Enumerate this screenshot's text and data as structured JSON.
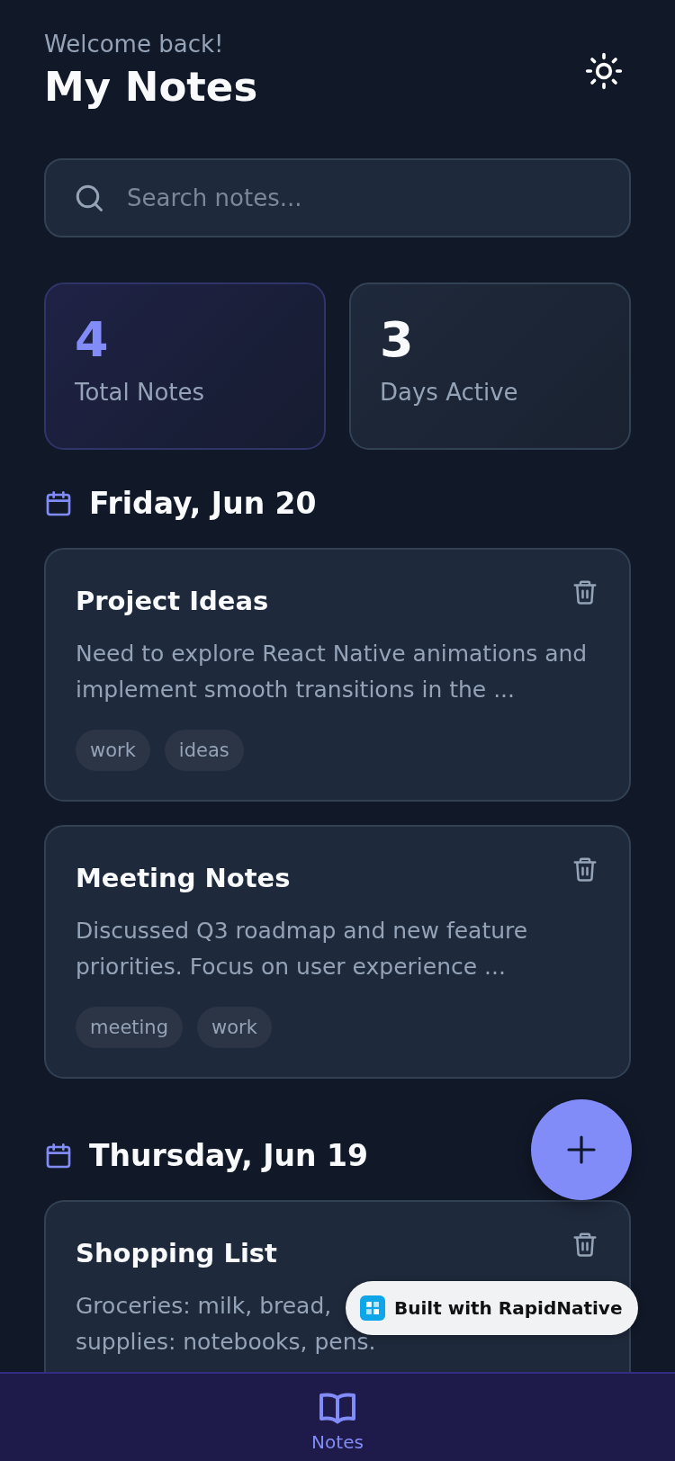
{
  "header": {
    "greeting": "Welcome back!",
    "title": "My Notes"
  },
  "search": {
    "placeholder": "Search notes..."
  },
  "stats": [
    {
      "value": "4",
      "label": "Total Notes",
      "kind": "accent"
    },
    {
      "value": "3",
      "label": "Days Active",
      "kind": "plain"
    }
  ],
  "groups": [
    {
      "date": "Friday, Jun 20",
      "notes": [
        {
          "title": "Project Ideas",
          "preview": "Need to explore React Native animations and implement smooth transitions in the ...",
          "tags": [
            "work",
            "ideas"
          ]
        },
        {
          "title": "Meeting Notes",
          "preview": "Discussed Q3 roadmap and new feature priorities. Focus on user experience ...",
          "tags": [
            "meeting",
            "work"
          ]
        }
      ]
    },
    {
      "date": "Thursday, Jun 19",
      "notes": [
        {
          "title": "Shopping List",
          "preview": "Groceries: milk, bread,",
          "preview_line_2": "supplies: notebooks, pens."
        }
      ]
    }
  ],
  "badge": {
    "text": "Built with RapidNative"
  },
  "tab_bar": [
    {
      "label": "Notes",
      "selected": true
    }
  ]
}
